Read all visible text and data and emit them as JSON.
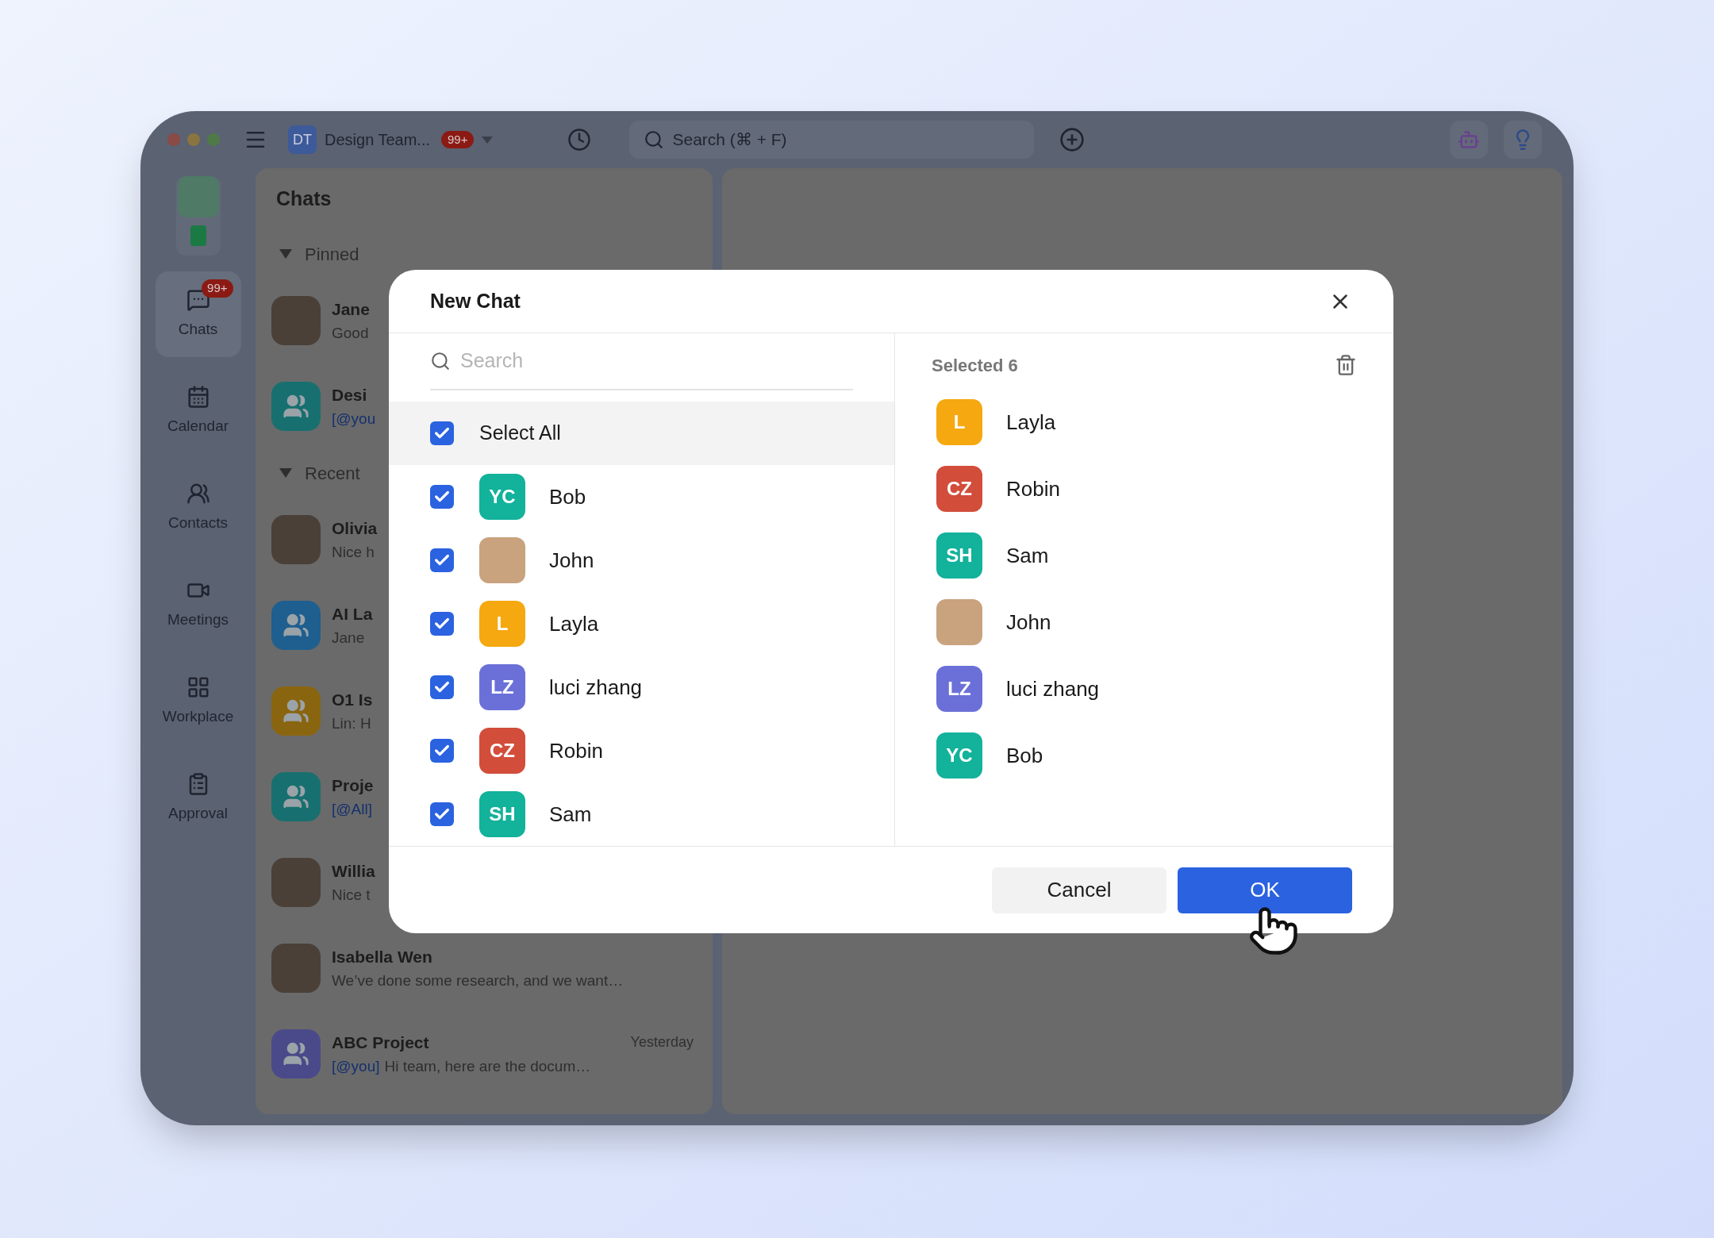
{
  "topbar": {
    "workspace": {
      "initials": "DT",
      "name": "Design Team...",
      "badge": "99+"
    },
    "search": {
      "placeholder": "Search (⌘ + F)"
    }
  },
  "sidebar": {
    "items": [
      {
        "label": "Chats",
        "selected": true,
        "badge": "99+"
      },
      {
        "label": "Calendar",
        "selected": false
      },
      {
        "label": "Contacts",
        "selected": false
      },
      {
        "label": "Meetings",
        "selected": false
      },
      {
        "label": "Workplace",
        "selected": false
      },
      {
        "label": "Approval",
        "selected": false
      }
    ]
  },
  "chat_list": {
    "title": "Chats",
    "sections": [
      {
        "label": "Pinned",
        "expanded": true,
        "chats": [
          {
            "name": "Jane",
            "preview": "Good"
          },
          {
            "name": "Desi",
            "mention": "[@you",
            "color": "#17706f"
          }
        ]
      },
      {
        "label": "Recent",
        "expanded": true,
        "chats": [
          {
            "name": "Olivia",
            "preview": "Nice h"
          },
          {
            "name": "AI La",
            "preview": "Jane",
            "color": "#1e5f8f"
          },
          {
            "name": "O1 Is",
            "preview": "Lin: H",
            "color": "#8a6510"
          },
          {
            "name": "Proje",
            "mention": "[@All]",
            "color": "#17706f"
          },
          {
            "name": "Willia",
            "preview": "Nice t"
          },
          {
            "name": "Isabella Wen",
            "preview": "We’ve done some research, and we want…"
          },
          {
            "name": "ABC Project",
            "mention": "[@you]",
            "preview": "Hi team, here are the docum…",
            "time": "Yesterday",
            "color": "#4a4a8a"
          }
        ]
      }
    ]
  },
  "dialog": {
    "title": "New Chat",
    "search": {
      "placeholder": "Search"
    },
    "select_all": {
      "label": "Select All",
      "checked": true
    },
    "contacts": [
      {
        "name": "Bob",
        "initials": "YC",
        "color": "#12b29b",
        "checked": true
      },
      {
        "name": "John",
        "checked": true
      },
      {
        "name": "Layla",
        "initials": "L",
        "color": "#f5a80f",
        "checked": true
      },
      {
        "name": "luci zhang",
        "initials": "LZ",
        "color": "#6b70d8",
        "checked": true
      },
      {
        "name": "Robin",
        "initials": "CZ",
        "color": "#d24d3a",
        "checked": true
      },
      {
        "name": "Sam",
        "initials": "SH",
        "color": "#12b29b",
        "checked": true
      }
    ],
    "selected": {
      "title": "Selected 6",
      "items": [
        {
          "name": "Layla",
          "initials": "L",
          "color": "#f5a80f"
        },
        {
          "name": "Robin",
          "initials": "CZ",
          "color": "#d24d3a"
        },
        {
          "name": "Sam",
          "initials": "SH",
          "color": "#12b29b"
        },
        {
          "name": "John"
        },
        {
          "name": "luci zhang",
          "initials": "LZ",
          "color": "#6b70d8"
        },
        {
          "name": "Bob",
          "initials": "YC",
          "color": "#12b29b"
        }
      ]
    },
    "buttons": [
      {
        "label": "Cancel",
        "kind": "secondary"
      },
      {
        "label": "OK",
        "kind": "primary"
      }
    ]
  }
}
